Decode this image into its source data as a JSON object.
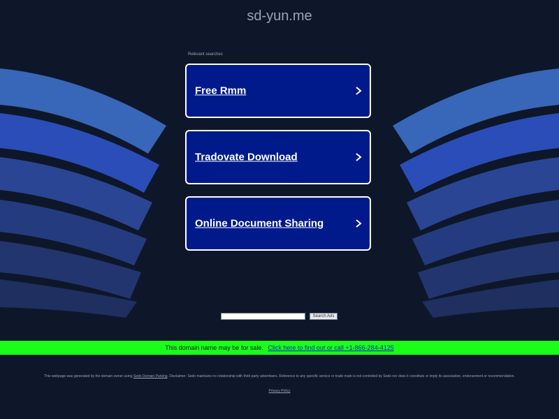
{
  "header": {
    "domain": "sd-yun.me"
  },
  "relevant_searches": {
    "label": "Relevant searches",
    "items": [
      {
        "label": "Free Rmm"
      },
      {
        "label": "Tradovate Download"
      },
      {
        "label": "Online Document Sharing"
      }
    ]
  },
  "search": {
    "placeholder": "",
    "button_label": "Search Ads"
  },
  "sale_bar": {
    "text": "This domain name may be for sale.",
    "link_text": "Click here to find out or call +1-866-284-4125"
  },
  "footer": {
    "disclaimer_prefix": "This webpage was generated by the domain owner using",
    "sedo_link": "Sedo Domain Parking",
    "disclaimer_suffix": ". Disclaimer: Sedo maintains no relationship with third party advertisers. Reference to any specific service or trade mark is not controlled by Sedo nor does it constitute or imply its association, endorsement or recommendation.",
    "privacy_link": "Privacy Policy"
  },
  "colors": {
    "background": "#0e1729",
    "link_box": "#001a8c",
    "sale_bar": "#19ff19"
  }
}
